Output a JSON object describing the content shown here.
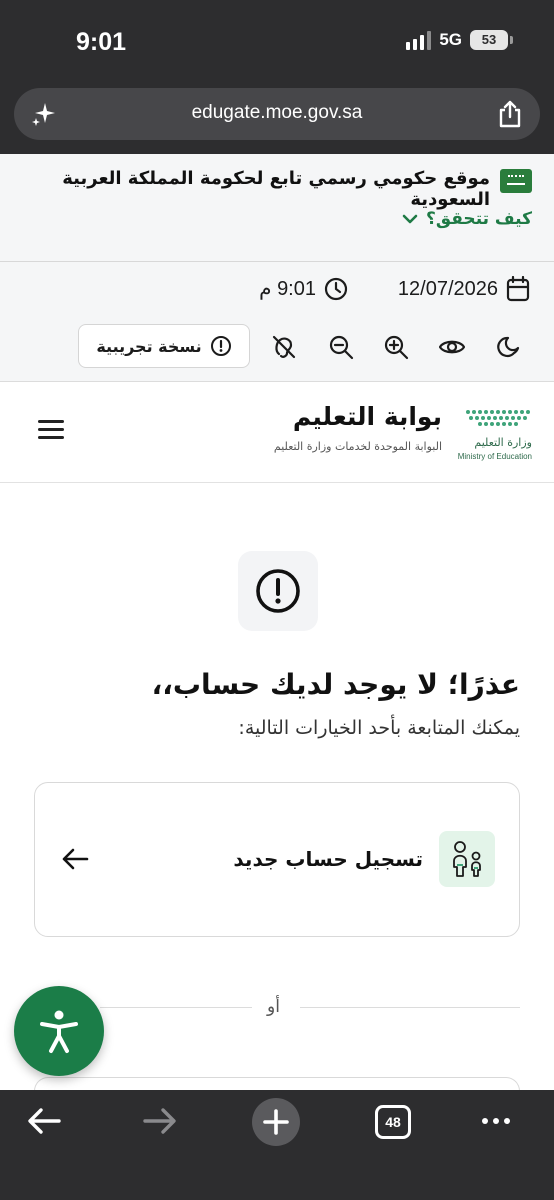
{
  "status_bar": {
    "time": "9:01",
    "network": "5G",
    "battery": "53"
  },
  "browser": {
    "url": "edugate.moe.gov.sa",
    "tab_count": "48"
  },
  "gov_banner": {
    "text": "موقع حكومي رسمي تابع لحكومة المملكة العربية السعودية",
    "verify_label": "كيف تتحقق؟"
  },
  "toolbar": {
    "date": "12/07/2026",
    "time": "9:01 م",
    "trial_label": "نسخة تجريبية"
  },
  "header": {
    "ministry_name": "وزارة التعليم",
    "ministry_en": "Ministry of Education",
    "portal_title": "بوابة التعليم",
    "portal_subtitle": "البوابة الموحدة لخدمات وزارة التعليم"
  },
  "main": {
    "heading": "عذرًا؛ لا يوجد لديك حساب،،",
    "subheading": "يمكنك المتابعة بأحد الخيارات التالية:",
    "option_register": "تسجيل حساب جديد",
    "or_label": "أو"
  },
  "colors": {
    "brand_green": "#1b7d48",
    "chrome_dark": "#2d2d2f"
  }
}
